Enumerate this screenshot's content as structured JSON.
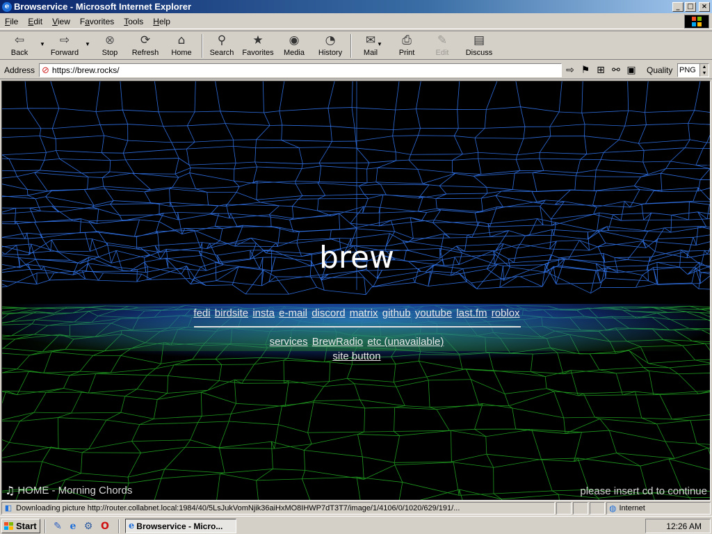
{
  "window": {
    "title": "Browservice - Microsoft Internet Explorer",
    "controls": {
      "minimize": "_",
      "maximize": "□",
      "close": "×"
    }
  },
  "menubar": {
    "items": [
      {
        "pre": "",
        "key": "F",
        "post": "ile"
      },
      {
        "pre": "",
        "key": "E",
        "post": "dit"
      },
      {
        "pre": "",
        "key": "V",
        "post": "iew"
      },
      {
        "pre": "F",
        "key": "a",
        "post": "vorites"
      },
      {
        "pre": "",
        "key": "T",
        "post": "ools"
      },
      {
        "pre": "",
        "key": "H",
        "post": "elp"
      }
    ]
  },
  "toolbar": {
    "back": "Back",
    "forward": "Forward",
    "stop": "Stop",
    "refresh": "Refresh",
    "home": "Home",
    "search": "Search",
    "favorites": "Favorites",
    "media": "Media",
    "history": "History",
    "mail": "Mail",
    "print": "Print",
    "edit": "Edit",
    "discuss": "Discuss"
  },
  "address": {
    "label": "Address",
    "url": "https://brew.rocks/",
    "quality_label": "Quality",
    "quality_value": "PNG"
  },
  "page": {
    "title": "brew",
    "links_row1": [
      "fedi",
      "birdsite",
      "insta",
      "e-mail",
      "discord",
      "matrix",
      "github",
      "youtube",
      "last.fm",
      "roblox"
    ],
    "links_row2": [
      "services",
      "BrewRadio",
      "etc (unavailable)"
    ],
    "links_row3": [
      "site button"
    ],
    "now_playing": "HOME - Morning Chords",
    "insert_cd": "please insert cd to continue",
    "colors": {
      "blue_mesh": "#2f6fe0",
      "green_mesh": "#1f9a1f",
      "background": "#000000"
    }
  },
  "statusbar": {
    "text": "Downloading picture http://router.collabnet.local:1984/40/5LsJukVomNjik36aiHxMO8IHWP7dT3T7/image/1/4106/0/1020/629/191/...",
    "zone": "Internet"
  },
  "taskbar": {
    "start": "Start",
    "task": "Browservice - Micro...",
    "clock": "12:26 AM"
  }
}
